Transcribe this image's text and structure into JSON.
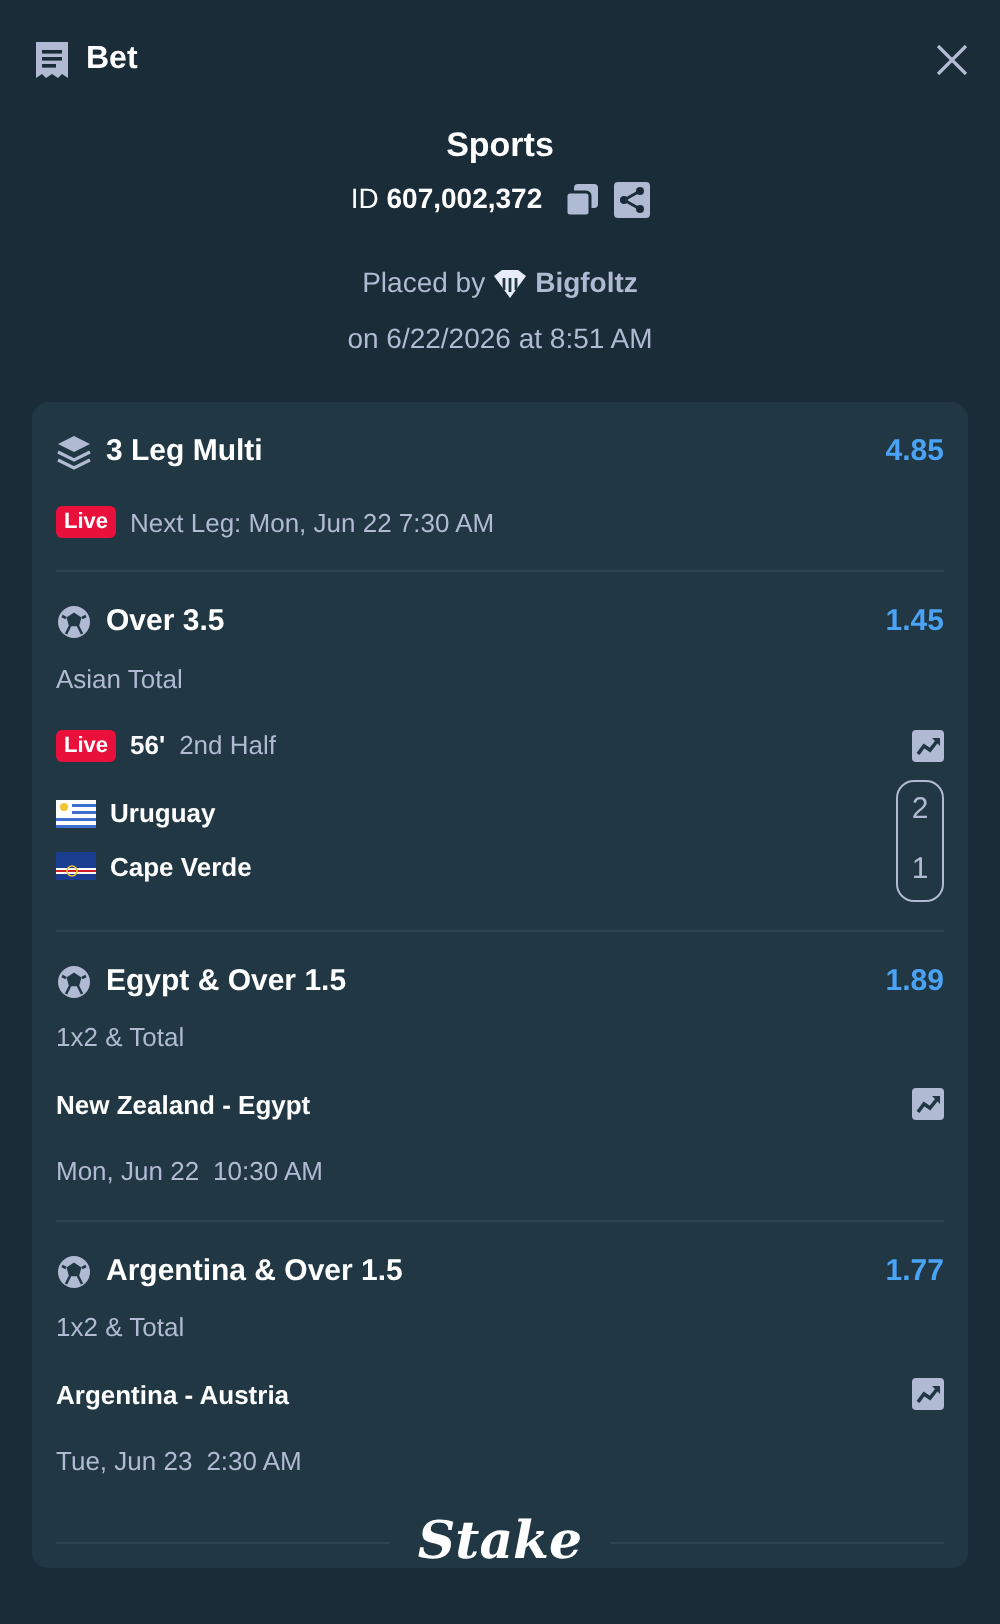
{
  "header": {
    "title": "Bet"
  },
  "summary": {
    "title": "Sports",
    "id_label": "ID",
    "id_value": "607,002,372",
    "placed_by_label": "Placed by",
    "user": "Bigfoltz",
    "placed_on": "on 6/22/2026 at 8:51 AM"
  },
  "multi": {
    "title": "3 Leg Multi",
    "odds": "4.85",
    "live_badge": "Live",
    "next_leg": "Next Leg: Mon, Jun 22 7:30 AM"
  },
  "legs": [
    {
      "kind": "live",
      "title": "Over 3.5",
      "odds": "1.45",
      "market": "Asian Total",
      "live_badge": "Live",
      "minute": "56'",
      "period": "2nd Half",
      "teams": [
        {
          "kind": "uruguay",
          "name": "Uruguay",
          "score": "2"
        },
        {
          "kind": "capeverde",
          "name": "Cape Verde",
          "score": "1"
        }
      ]
    },
    {
      "kind": "scheduled",
      "title": "Egypt & Over 1.5",
      "odds": "1.89",
      "market": "1x2 & Total",
      "match": "New Zealand - Egypt",
      "date": "Mon, Jun 22",
      "time": "10:30 AM"
    },
    {
      "kind": "scheduled",
      "title": "Argentina & Over 1.5",
      "odds": "1.77",
      "market": "1x2 & Total",
      "match": "Argentina - Austria",
      "date": "Tue, Jun 23",
      "time": "2:30 AM"
    }
  ],
  "footer": {
    "brand": "Stake"
  }
}
